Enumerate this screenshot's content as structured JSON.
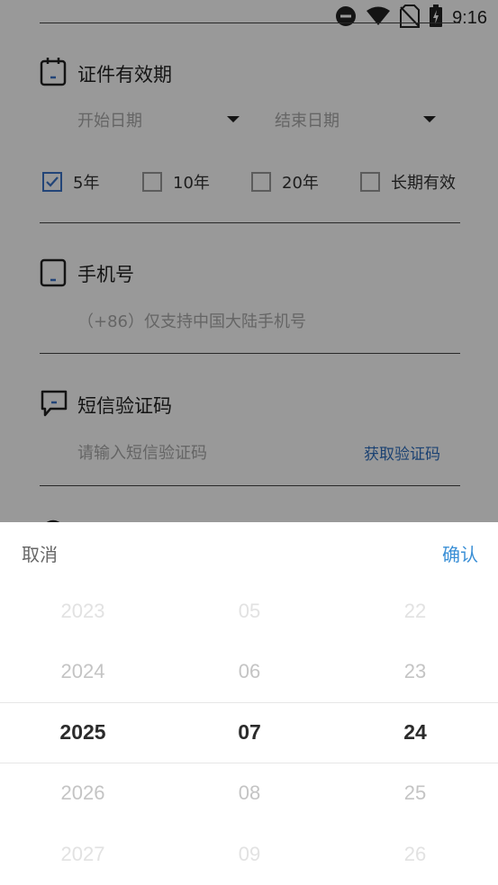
{
  "status": {
    "time": "9:16"
  },
  "validity": {
    "title": "证件有效期",
    "start_placeholder": "开始日期",
    "end_placeholder": "结束日期",
    "options": [
      {
        "label": "5年",
        "checked": true
      },
      {
        "label": "10年",
        "checked": false
      },
      {
        "label": "20年",
        "checked": false
      },
      {
        "label": "长期有效",
        "checked": false
      }
    ]
  },
  "phone": {
    "title": "手机号",
    "placeholder": "（+86）仅支持中国大陆手机号"
  },
  "sms": {
    "title": "短信验证码",
    "placeholder": "请输入短信验证码",
    "get_code": "获取验证码"
  },
  "picker": {
    "cancel": "取消",
    "confirm": "确认",
    "years": [
      "2023",
      "2024",
      "2025",
      "2026",
      "2027"
    ],
    "months": [
      "05",
      "06",
      "07",
      "08",
      "09"
    ],
    "days": [
      "22",
      "23",
      "24",
      "25",
      "26"
    ]
  },
  "colors": {
    "accent": "#3a8fd6",
    "link": "#2f6fbf",
    "checkbox_checked": "#3b74c9"
  }
}
